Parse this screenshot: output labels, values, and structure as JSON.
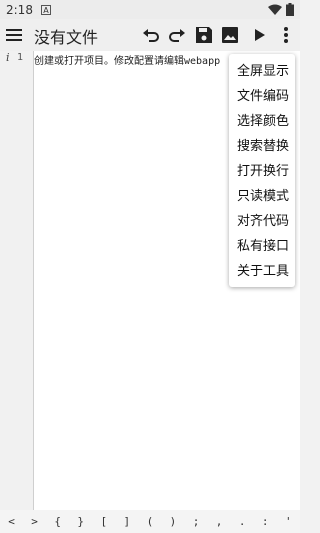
{
  "status_bar": {
    "time": "2:18",
    "notification_letter": "A"
  },
  "toolbar": {
    "title": "没有文件",
    "icons": [
      "menu-icon",
      "undo-icon",
      "redo-icon",
      "save-icon",
      "image-icon",
      "play-icon",
      "more-vert-icon"
    ]
  },
  "editor": {
    "info_marker": "i",
    "line_number": "1",
    "line_text": "创建或打开项目。修改配置请编辑webapp"
  },
  "symbol_bar": {
    "symbols": [
      "<",
      ">",
      "{",
      "}",
      "[",
      "]",
      "(",
      ")",
      ";",
      ",",
      ".",
      ":",
      "'"
    ]
  },
  "overflow_menu": {
    "items": [
      "全屏显示",
      "文件编码",
      "选择颜色",
      "搜索替换",
      "打开换行",
      "只读模式",
      "对齐代码",
      "私有接口",
      "关于工具"
    ]
  },
  "colors": {
    "toolbar_bg": "#efefef",
    "editor_bg": "#ffffff",
    "gutter_bg": "#f1f1f1",
    "menu_bg": "#ffffff"
  }
}
